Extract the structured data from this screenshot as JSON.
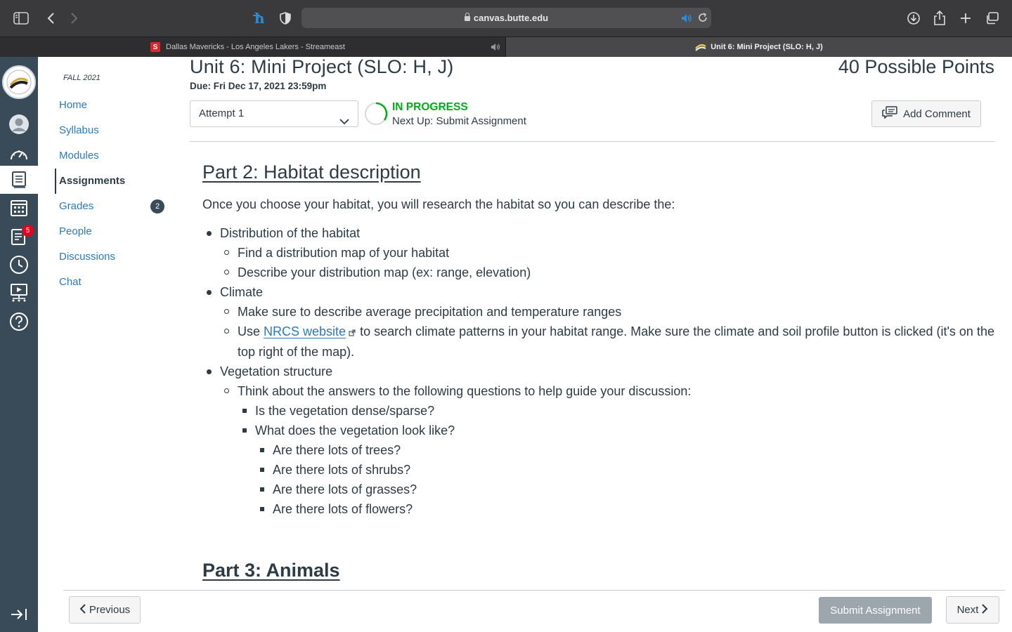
{
  "browser": {
    "url": "canvas.butte.edu",
    "tabs": [
      {
        "title": "Dallas Mavericks - Los Angeles Lakers - Streameast",
        "favicon_letter": "S"
      },
      {
        "title": "Unit 6: Mini Project (SLO: H, J)"
      }
    ]
  },
  "global_nav": {
    "inbox_badge": "5"
  },
  "course_nav": {
    "term": "FALL 2021",
    "items": [
      {
        "label": "Home"
      },
      {
        "label": "Syllabus"
      },
      {
        "label": "Modules"
      },
      {
        "label": "Assignments",
        "active": true
      },
      {
        "label": "Grades",
        "badge": "2"
      },
      {
        "label": "People"
      },
      {
        "label": "Discussions"
      },
      {
        "label": "Chat"
      }
    ]
  },
  "assignment": {
    "title": "Unit 6: Mini Project (SLO: H, J)",
    "points": "40 Possible Points",
    "due": "Due: Fri Dec 17, 2021 23:59pm",
    "attempt": "Attempt 1",
    "status": "IN PROGRESS",
    "next_up": "Next Up: Submit Assignment",
    "add_comment": "Add Comment"
  },
  "content": {
    "part2_heading": "Part 2: Habitat description",
    "intro": "Once you choose your habitat, you will research the habitat so you can describe the:",
    "distribution": {
      "label": "Distribution of the habitat",
      "sub": [
        "Find a distribution map of your habitat",
        "Describe your distribution map (ex: range, elevation)"
      ]
    },
    "climate": {
      "label": "Climate",
      "sub1": "Make sure to describe average precipitation and temperature ranges",
      "sub2_pre": "Use",
      "sub2_link": "NRCS website",
      "sub2_post": "to search climate patterns in your habitat range. Make sure the climate and soil profile button is clicked (it's on the top right of the map)."
    },
    "vegetation": {
      "label": "Vegetation structure",
      "sub": "Think about the answers to the following questions to help guide your discussion:",
      "q1": "Is the vegetation dense/sparse?",
      "q2": "What does the vegetation look like?",
      "q2_sub": [
        "Are there lots of trees?",
        "Are there lots of shrubs?",
        "Are there lots of grasses?",
        "Are there lots of flowers?"
      ]
    },
    "part3_heading": "Part 3: Animals"
  },
  "footer": {
    "previous": "Previous",
    "submit": "Submit Assignment",
    "next": "Next"
  },
  "colors": {
    "link": "#2b7abc",
    "status_green": "#00ac18",
    "nav_bg": "#394b58",
    "badge_red": "#e0061f"
  }
}
